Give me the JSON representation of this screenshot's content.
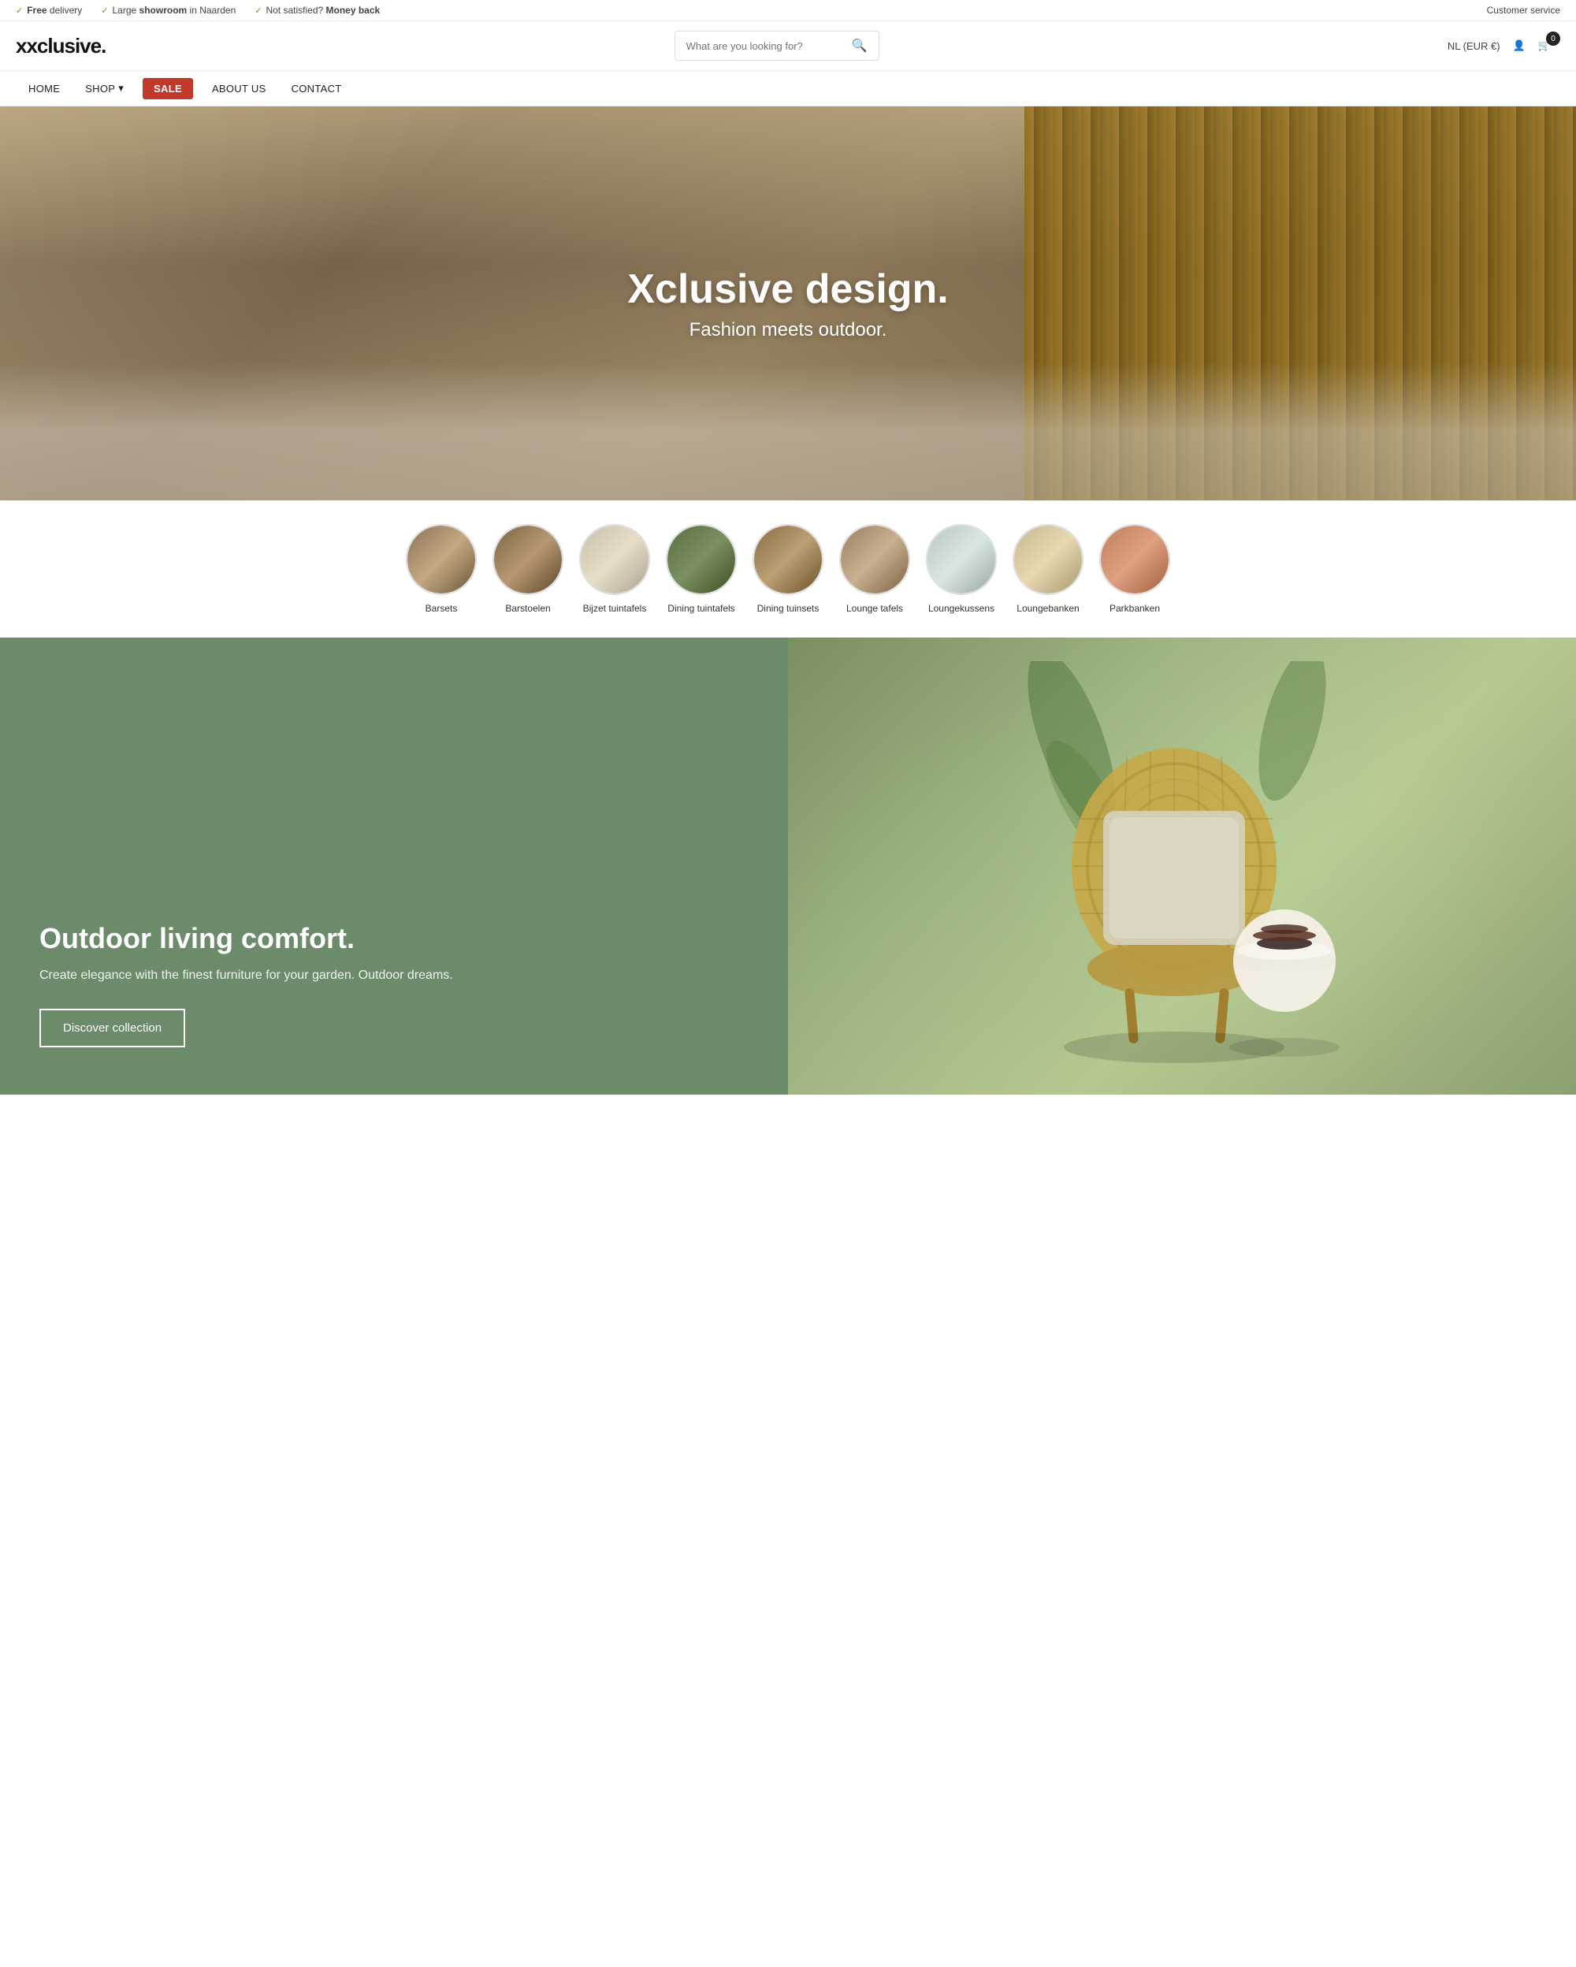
{
  "topbar": {
    "items": [
      {
        "icon": "✓",
        "bold": "Free",
        "text": "delivery"
      },
      {
        "icon": "✓",
        "bold": "Large showroom",
        "text": "in Naarden"
      },
      {
        "icon": "✓",
        "bold": "Not satisfied?",
        "bold2": "Money back"
      }
    ],
    "right": "Customer service"
  },
  "header": {
    "logo": "xclusive.",
    "search_placeholder": "What are you looking for?",
    "currency": "NL (EUR €)",
    "cart_count": "0"
  },
  "nav": {
    "items": [
      {
        "label": "HOME",
        "active": true
      },
      {
        "label": "SHOP",
        "has_dropdown": true
      },
      {
        "label": "SALE",
        "is_sale": true
      },
      {
        "label": "ABOUT US"
      },
      {
        "label": "CONTACT"
      }
    ]
  },
  "hero": {
    "title": "Xclusive design.",
    "subtitle": "Fashion meets outdoor."
  },
  "categories": [
    {
      "label": "Barsets",
      "class": "cat-barsets"
    },
    {
      "label": "Barstoelen",
      "class": "cat-barstoelen"
    },
    {
      "label": "Bijzet tuintafels",
      "class": "cat-bijzet"
    },
    {
      "label": "Dining tuintafels",
      "class": "cat-dining-tafels"
    },
    {
      "label": "Dining tuinsets",
      "class": "cat-dining-tuinsets"
    },
    {
      "label": "Lounge tafels",
      "class": "cat-lounge-tafels"
    },
    {
      "label": "Loungekussens",
      "class": "cat-loungekussens"
    },
    {
      "label": "Loungebanken",
      "class": "cat-loungebanken"
    },
    {
      "label": "Parkbanken",
      "class": "cat-parkbanken"
    }
  ],
  "promo": {
    "title": "Outdoor living comfort.",
    "description": "Create elegance with the finest furniture for your garden. Outdoor dreams.",
    "button": "Discover collection"
  }
}
